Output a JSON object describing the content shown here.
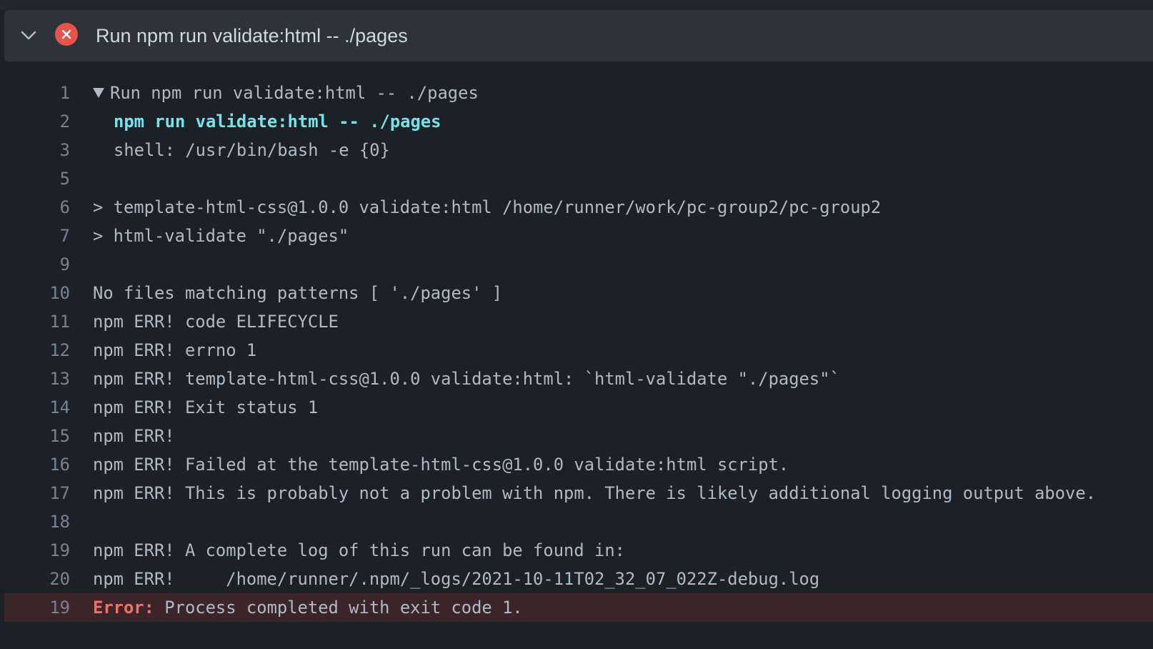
{
  "step": {
    "title": "Run npm run validate:html -- ./pages",
    "status": "failed",
    "status_color": "#e5534b",
    "expand_icon": "chevron-down-icon",
    "status_icon": "x-circle-icon"
  },
  "log": {
    "lines": [
      {
        "num": "1",
        "text": "Run npm run validate:html -- ./pages",
        "kind": "group"
      },
      {
        "num": "2",
        "text": "npm run validate:html -- ./pages",
        "kind": "cmd"
      },
      {
        "num": "3",
        "text": "shell: /usr/bin/bash -e {0}",
        "kind": "indent"
      },
      {
        "num": "5",
        "text": "",
        "kind": "plain"
      },
      {
        "num": "6",
        "text": "> template-html-css@1.0.0 validate:html /home/runner/work/pc-group2/pc-group2",
        "kind": "plain"
      },
      {
        "num": "7",
        "text": "> html-validate \"./pages\"",
        "kind": "plain"
      },
      {
        "num": "9",
        "text": "",
        "kind": "plain"
      },
      {
        "num": "10",
        "text": "No files matching patterns [ './pages' ]",
        "kind": "plain"
      },
      {
        "num": "11",
        "text": "npm ERR! code ELIFECYCLE",
        "kind": "plain"
      },
      {
        "num": "12",
        "text": "npm ERR! errno 1",
        "kind": "plain"
      },
      {
        "num": "13",
        "text": "npm ERR! template-html-css@1.0.0 validate:html: `html-validate \"./pages\"`",
        "kind": "plain"
      },
      {
        "num": "14",
        "text": "npm ERR! Exit status 1",
        "kind": "plain"
      },
      {
        "num": "15",
        "text": "npm ERR!",
        "kind": "plain"
      },
      {
        "num": "16",
        "text": "npm ERR! Failed at the template-html-css@1.0.0 validate:html script.",
        "kind": "plain"
      },
      {
        "num": "17",
        "text": "npm ERR! This is probably not a problem with npm. There is likely additional logging output above.",
        "kind": "plain"
      },
      {
        "num": "18",
        "text": "",
        "kind": "plain"
      },
      {
        "num": "19",
        "text": "npm ERR! A complete log of this run can be found in:",
        "kind": "plain"
      },
      {
        "num": "20",
        "text": "npm ERR!     /home/runner/.npm/_logs/2021-10-11T02_32_07_022Z-debug.log",
        "kind": "plain"
      }
    ],
    "error_line": {
      "num": "19",
      "label": "Error:",
      "text": " Process completed with exit code 1."
    }
  },
  "colors": {
    "background": "#1c2128",
    "header_background": "#2d333b",
    "command_text": "#76e3ea",
    "error_text": "#f47067",
    "error_background": "#3b2528"
  }
}
